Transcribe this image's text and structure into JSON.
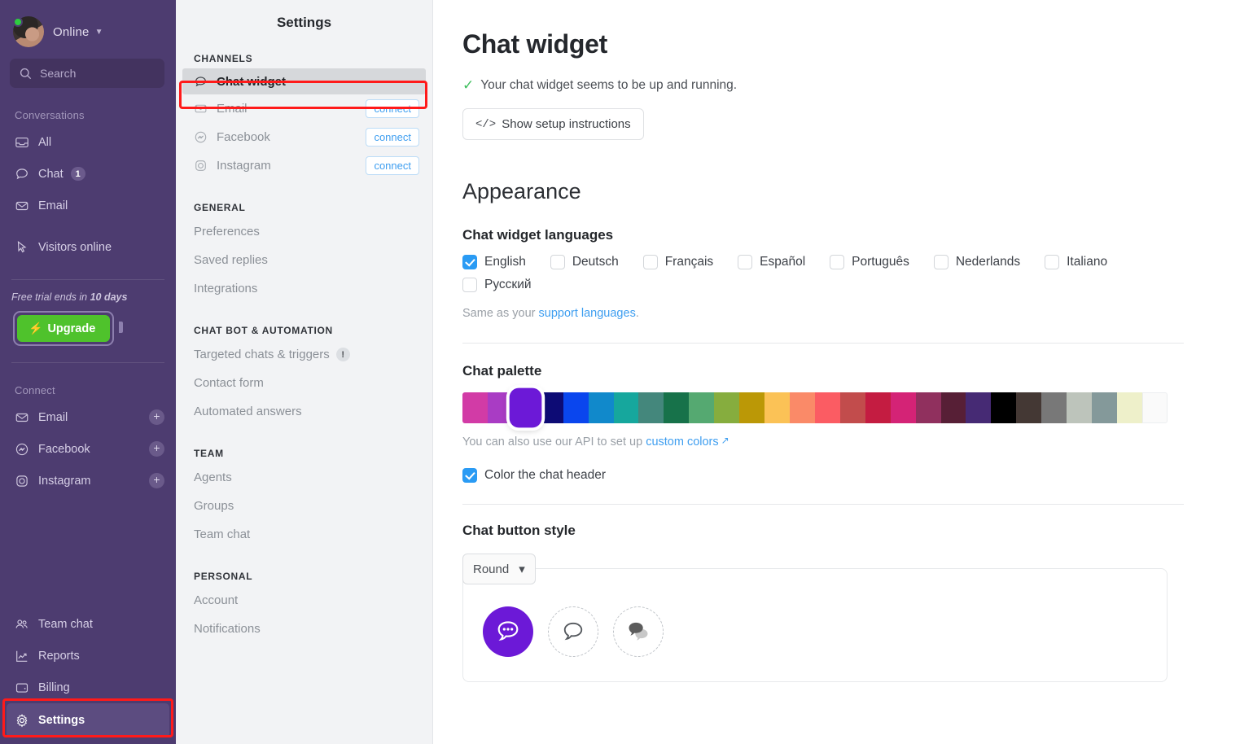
{
  "colors": {
    "nav_bg": "#4d3c70",
    "accent_purple": "#6c19d7",
    "link_blue": "#3e9ef0",
    "upgrade_green": "#4fc22c",
    "highlight_red": "#ff1a1a",
    "checkbox_blue": "#2a9bf4"
  },
  "leftnav": {
    "presence": {
      "status_label": "Online",
      "status_dot": "online-green",
      "caret": "⌄"
    },
    "search": {
      "placeholder": "Search",
      "icon": "search-icon"
    },
    "conversations_title": "Conversations",
    "conversations": [
      {
        "label": "All",
        "icon": "inbox-icon",
        "badge": ""
      },
      {
        "label": "Chat",
        "icon": "chat-bubble-icon",
        "badge": "1"
      },
      {
        "label": "Email",
        "icon": "envelope-icon",
        "badge": ""
      }
    ],
    "visitors": {
      "label": "Visitors online",
      "icon": "cursor-icon"
    },
    "trial": {
      "prefix": "Free trial ends in",
      "days": "10 days"
    },
    "upgrade_button": {
      "label": "Upgrade",
      "icon": "bolt-icon"
    },
    "connect_title": "Connect",
    "connect_items": [
      {
        "label": "Email",
        "icon": "envelope-icon",
        "action": "+"
      },
      {
        "label": "Facebook",
        "icon": "messenger-icon",
        "action": "+"
      },
      {
        "label": "Instagram",
        "icon": "instagram-icon",
        "action": "+"
      }
    ],
    "bottom_items": [
      {
        "label": "Team chat",
        "icon": "people-icon"
      },
      {
        "label": "Reports",
        "icon": "chart-icon"
      },
      {
        "label": "Billing",
        "icon": "wallet-icon"
      },
      {
        "label": "Settings",
        "icon": "gear-icon"
      }
    ]
  },
  "settings_panel": {
    "title": "Settings",
    "groups": [
      {
        "title": "CHANNELS",
        "items": [
          {
            "label": "Chat widget",
            "icon": "chat-bubble-icon",
            "selected": true,
            "action": ""
          },
          {
            "label": "Email",
            "icon": "envelope-icon",
            "selected": false,
            "action": "connect"
          },
          {
            "label": "Facebook",
            "icon": "messenger-icon",
            "selected": false,
            "action": "connect"
          },
          {
            "label": "Instagram",
            "icon": "instagram-icon",
            "selected": false,
            "action": "connect"
          }
        ]
      },
      {
        "title": "GENERAL",
        "items": [
          {
            "label": "Preferences",
            "icon": "",
            "selected": false,
            "action": ""
          },
          {
            "label": "Saved replies",
            "icon": "",
            "selected": false,
            "action": ""
          },
          {
            "label": "Integrations",
            "icon": "",
            "selected": false,
            "action": ""
          }
        ]
      },
      {
        "title": "CHAT BOT & AUTOMATION",
        "items": [
          {
            "label": "Targeted chats & triggers",
            "icon": "",
            "selected": false,
            "action": "",
            "warn": "!"
          },
          {
            "label": "Contact form",
            "icon": "",
            "selected": false,
            "action": ""
          },
          {
            "label": "Automated answers",
            "icon": "",
            "selected": false,
            "action": ""
          }
        ]
      },
      {
        "title": "TEAM",
        "items": [
          {
            "label": "Agents",
            "icon": "",
            "selected": false,
            "action": ""
          },
          {
            "label": "Groups",
            "icon": "",
            "selected": false,
            "action": ""
          },
          {
            "label": "Team chat",
            "icon": "",
            "selected": false,
            "action": ""
          }
        ]
      },
      {
        "title": "PERSONAL",
        "items": [
          {
            "label": "Account",
            "icon": "",
            "selected": false,
            "action": ""
          },
          {
            "label": "Notifications",
            "icon": "",
            "selected": false,
            "action": ""
          }
        ]
      }
    ]
  },
  "main": {
    "page_title": "Chat widget",
    "status_text": "Your chat widget seems to be up and running.",
    "status_icon": "check-icon",
    "setup_button": {
      "label": "Show setup instructions",
      "icon": "code-icon"
    },
    "appearance_heading": "Appearance",
    "languages_heading": "Chat widget languages",
    "languages": [
      {
        "label": "English",
        "checked": true
      },
      {
        "label": "Deutsch",
        "checked": false
      },
      {
        "label": "Français",
        "checked": false
      },
      {
        "label": "Español",
        "checked": false
      },
      {
        "label": "Português",
        "checked": false
      },
      {
        "label": "Nederlands",
        "checked": false
      },
      {
        "label": "Italiano",
        "checked": false
      },
      {
        "label": "Русский",
        "checked": false
      }
    ],
    "languages_hint_prefix": "Same as your ",
    "languages_hint_link": "support languages",
    "languages_hint_suffix": ".",
    "palette_heading": "Chat palette",
    "palette_colors": [
      "#d23ba6",
      "#a93cc4",
      "#6c19d7",
      "#0d0b75",
      "#0a46ee",
      "#1189cb",
      "#16a79d",
      "#44877c",
      "#17724a",
      "#55a971",
      "#86ad3e",
      "#bb9806",
      "#fbc256",
      "#fa8a68",
      "#fb5c63",
      "#c24c4c",
      "#c41c41",
      "#d42376",
      "#90305e",
      "#571f36",
      "#462a74",
      "#000000",
      "#443834",
      "#787878",
      "#bdc4bb",
      "#84999a",
      "#eef0ca",
      "#fafafa"
    ],
    "palette_selected_index": 2,
    "palette_hint_prefix": "You can also use our API to set up ",
    "palette_hint_link": "custom colors",
    "palette_hint_external_icon": "external-link-icon",
    "color_header_checkbox": {
      "label": "Color the chat header",
      "checked": true
    },
    "button_style_heading": "Chat button style",
    "button_style_select": {
      "value": "Round",
      "caret": "⌄"
    },
    "button_style_options": [
      {
        "name": "round-filled-bubble-dots",
        "selected": true
      },
      {
        "name": "outline-bubble",
        "selected": false
      },
      {
        "name": "double-bubble",
        "selected": false
      }
    ]
  }
}
